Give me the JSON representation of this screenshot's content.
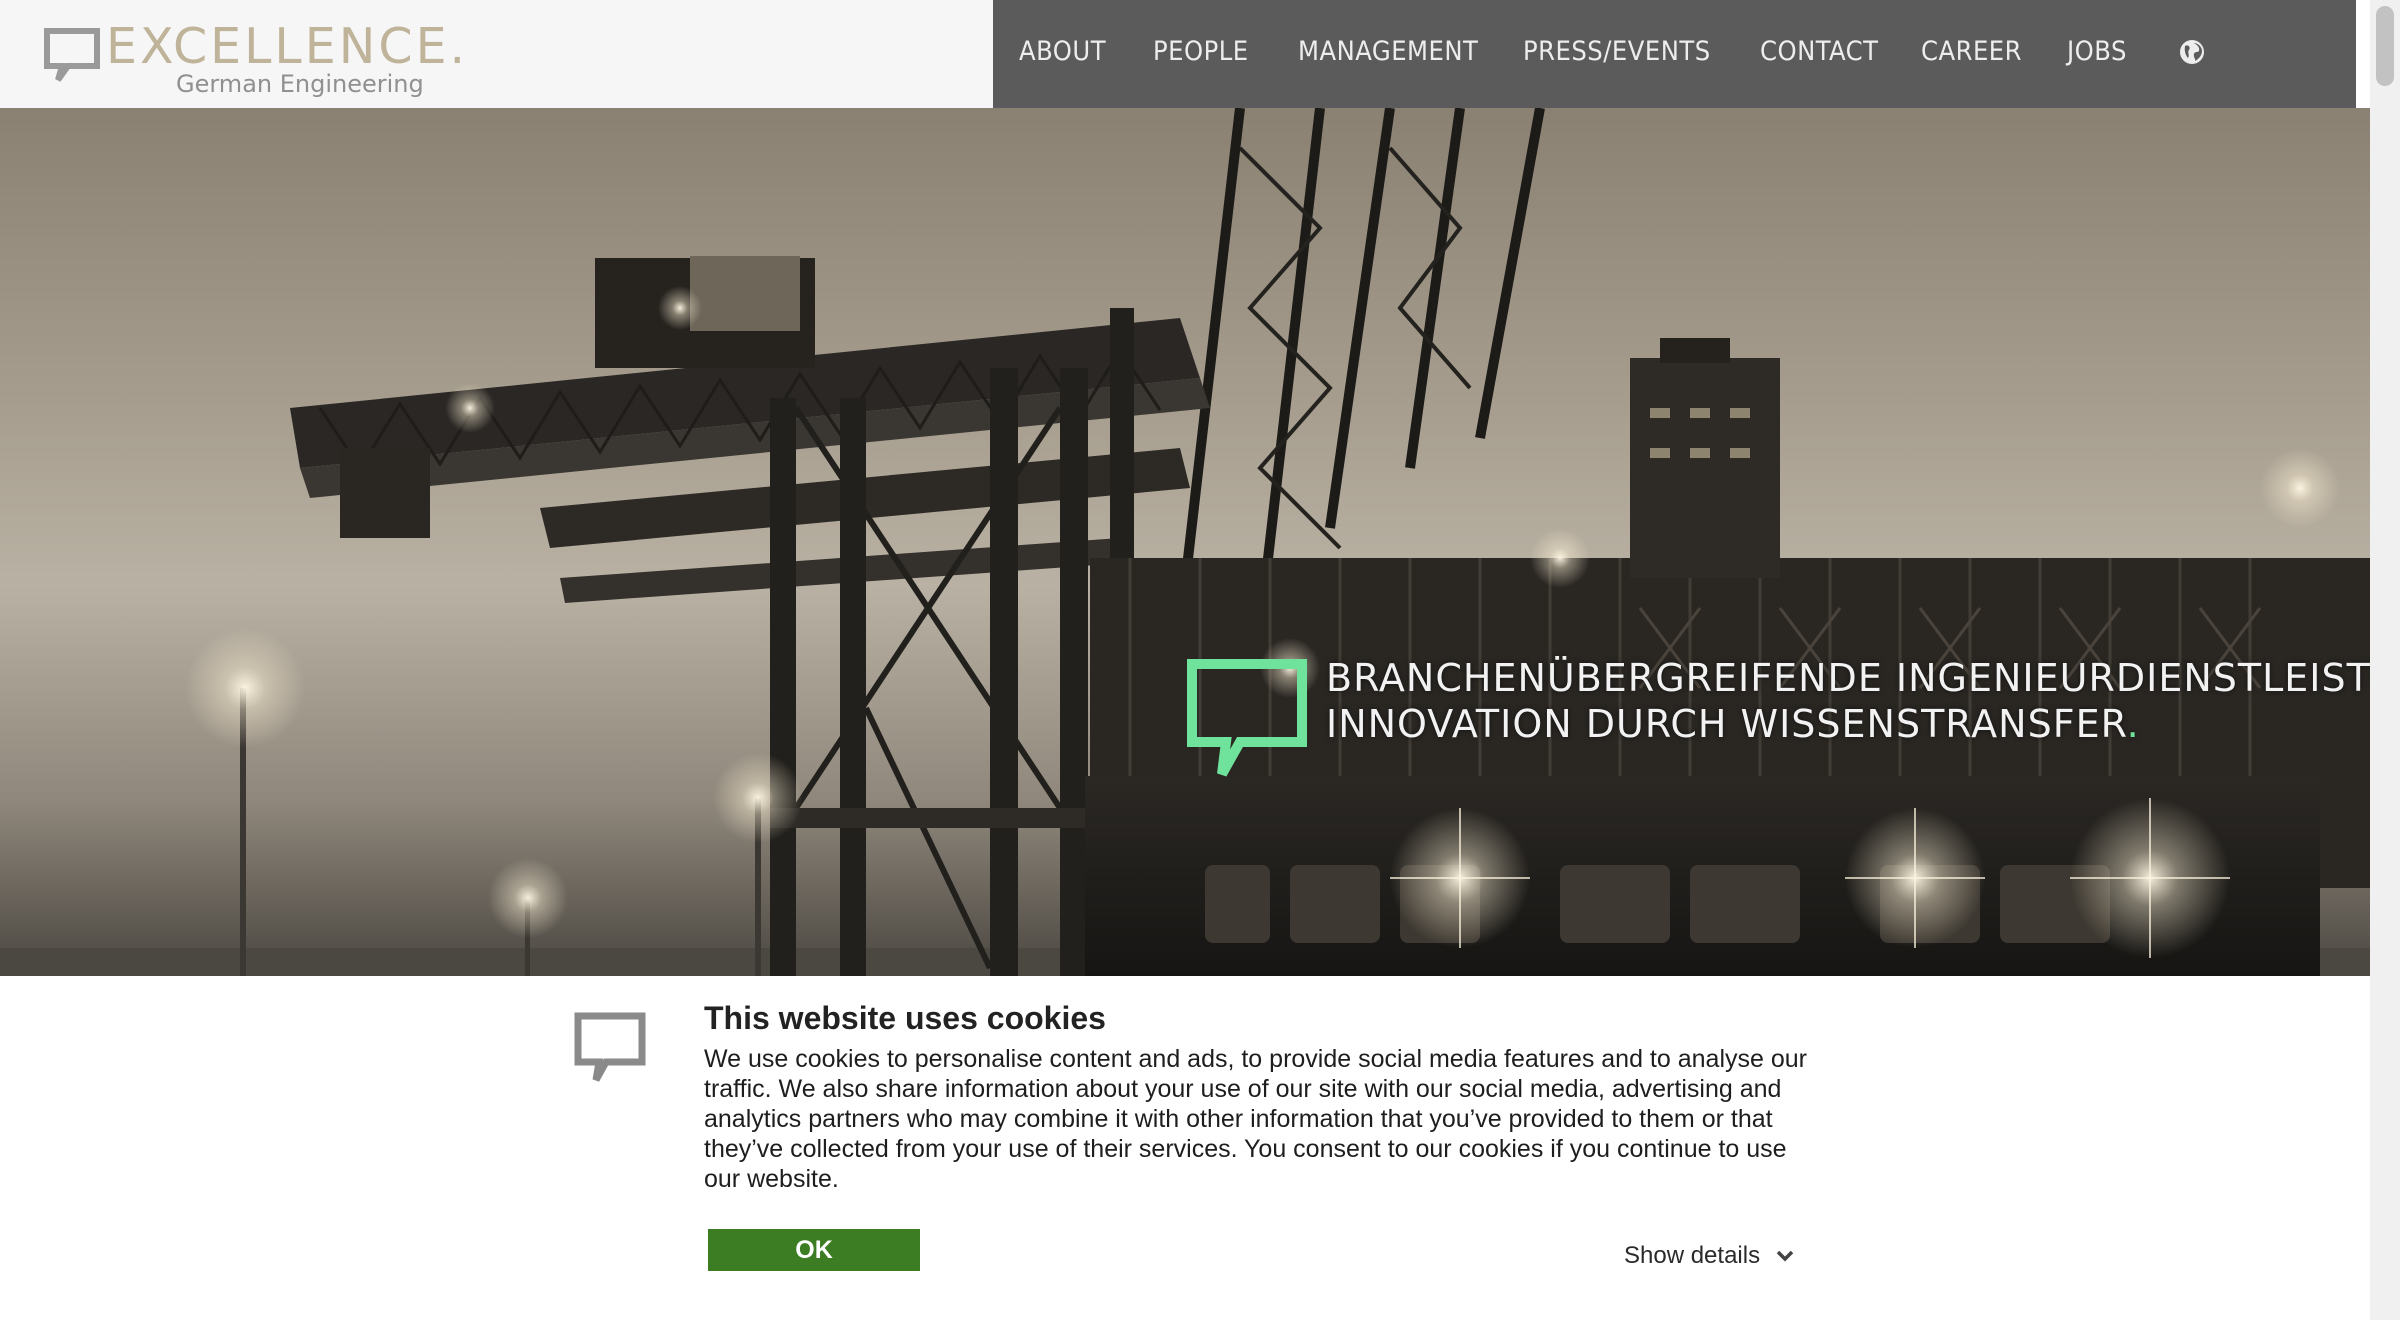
{
  "brand": {
    "name": "EXCELLENCE.",
    "tagline": "German Engineering",
    "accent_color": "#bfb399"
  },
  "nav": {
    "items": [
      {
        "label": "ABOUT"
      },
      {
        "label": "PEOPLE"
      },
      {
        "label": "MANAGEMENT"
      },
      {
        "label": "PRESS/EVENTS"
      },
      {
        "label": "CONTACT"
      },
      {
        "label": "CAREER"
      },
      {
        "label": "JOBS"
      }
    ],
    "language_icon": "globe-icon",
    "background_color": "#5b5b5b"
  },
  "hero": {
    "line1": "BRANCHENÜBERGREIFENDE INGENIEURDIENSTLEISTUNG.",
    "line2": "INNOVATION DURCH WISSENSTRANSFER",
    "line2_dot": ".",
    "accent_color": "#6fe39b"
  },
  "cookie_banner": {
    "title": "This website uses cookies",
    "body": "We use cookies to personalise content and ads, to provide social media features and to analyse our traffic. We also share information about your use of our site with our social media, advertising and analytics partners who may combine it with other information that you’ve provided to them or that they’ve collected from your use of their services. You consent to our cookies if you continue to use our website.",
    "ok_label": "OK",
    "details_label": "Show details",
    "ok_color": "#3c7d24"
  }
}
